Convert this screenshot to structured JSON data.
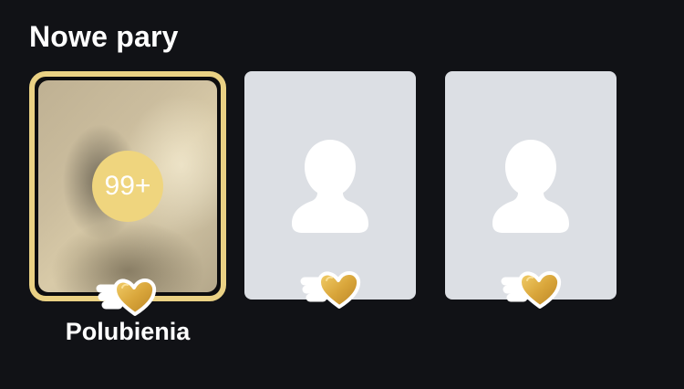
{
  "section": {
    "title": "Nowe pary"
  },
  "likes_card": {
    "count": "99+",
    "label": "Polubienia",
    "badge_icon": "gold-heart-icon"
  },
  "match_cards": [
    {
      "icon": "person-silhouette-icon",
      "badge_icon": "gold-heart-icon"
    },
    {
      "icon": "person-silhouette-icon",
      "badge_icon": "gold-heart-icon"
    }
  ],
  "colors": {
    "background": "#111216",
    "gold_border": "#ead184",
    "gold_badge": "#efd57e",
    "placeholder": "#dcdfe4",
    "text": "#ffffff"
  }
}
